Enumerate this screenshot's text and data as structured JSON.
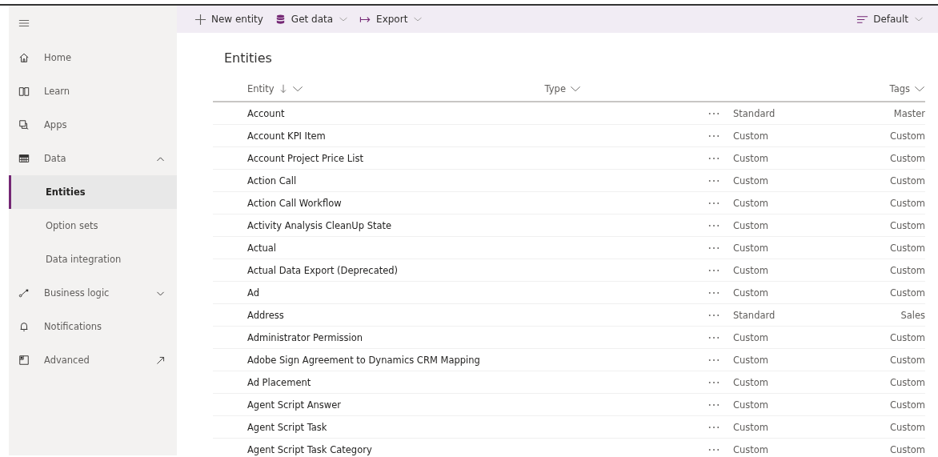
{
  "sidebar": {
    "items": [
      {
        "label": "Home",
        "kind": "main",
        "selected": false
      },
      {
        "label": "Learn",
        "kind": "main",
        "selected": false
      },
      {
        "label": "Apps",
        "kind": "main",
        "selected": false
      },
      {
        "label": "Data",
        "kind": "main",
        "selected": false
      },
      {
        "label": "Entities",
        "kind": "sub",
        "selected": true
      },
      {
        "label": "Option sets",
        "kind": "sub",
        "selected": false
      },
      {
        "label": "Data integration",
        "kind": "sub",
        "selected": false
      },
      {
        "label": "Business logic",
        "kind": "main",
        "selected": false
      },
      {
        "label": "Notifications",
        "kind": "main",
        "selected": false
      },
      {
        "label": "Advanced",
        "kind": "main",
        "selected": false
      }
    ]
  },
  "toolbar": {
    "actions": [
      {
        "label": "New entity",
        "dropdown": false
      },
      {
        "label": "Get data",
        "dropdown": true
      },
      {
        "label": "Export",
        "dropdown": true
      }
    ],
    "view": {
      "label": "Default",
      "dropdown": true
    }
  },
  "page_title": "Entities",
  "table": {
    "columns": [
      "Entity",
      "Type",
      "Tags"
    ],
    "rows": [
      [
        "Account",
        "Standard",
        "Master"
      ],
      [
        "Account KPI Item",
        "Custom",
        "Custom"
      ],
      [
        "Account Project Price List",
        "Custom",
        "Custom"
      ],
      [
        "Action Call",
        "Custom",
        "Custom"
      ],
      [
        "Action Call Workflow",
        "Custom",
        "Custom"
      ],
      [
        "Activity Analysis CleanUp State",
        "Custom",
        "Custom"
      ],
      [
        "Actual",
        "Custom",
        "Custom"
      ],
      [
        "Actual Data Export (Deprecated)",
        "Custom",
        "Custom"
      ],
      [
        "Ad",
        "Custom",
        "Custom"
      ],
      [
        "Address",
        "Standard",
        "Sales"
      ],
      [
        "Administrator Permission",
        "Custom",
        "Custom"
      ],
      [
        "Adobe Sign Agreement to Dynamics CRM Mapping",
        "Custom",
        "Custom"
      ],
      [
        "Ad Placement",
        "Custom",
        "Custom"
      ],
      [
        "Agent Script Answer",
        "Custom",
        "Custom"
      ],
      [
        "Agent Script Task",
        "Custom",
        "Custom"
      ],
      [
        "Agent Script Task Category",
        "Custom",
        "Custom"
      ]
    ]
  }
}
